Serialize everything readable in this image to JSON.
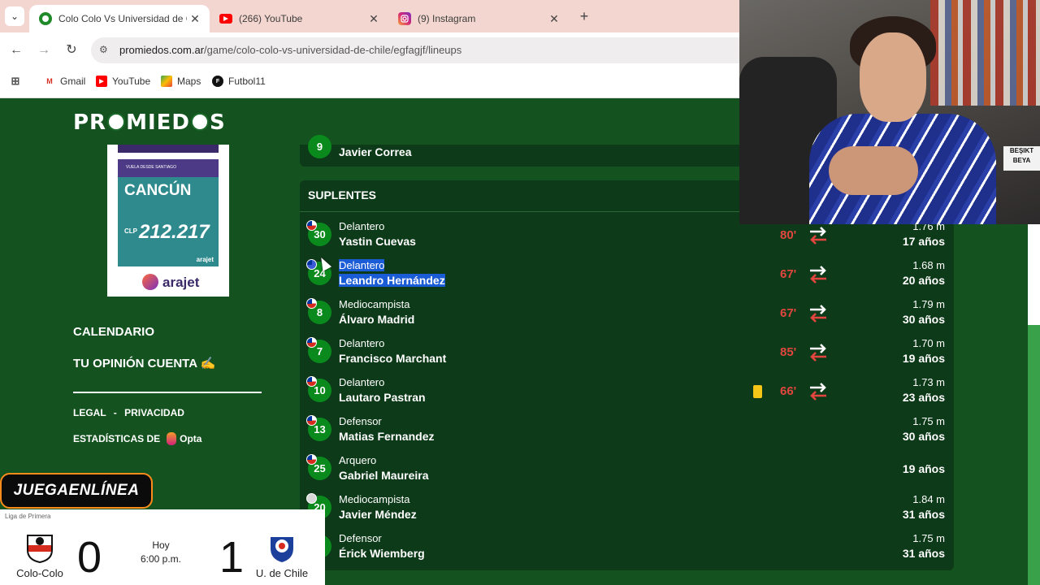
{
  "browser": {
    "tabs": [
      {
        "title": "Colo Colo Vs Universidad de Ch",
        "icon": "promiedos-icon",
        "active": true
      },
      {
        "title": "(266) YouTube",
        "icon": "youtube-icon",
        "active": false
      },
      {
        "title": "(9) Instagram",
        "icon": "instagram-icon",
        "active": false
      }
    ],
    "url_domain": "promiedos.com.ar",
    "url_path": "/game/colo-colo-vs-universidad-de-chile/egfagjf/lineups",
    "bookmarks": [
      "Gmail",
      "YouTube",
      "Maps",
      "Futbol11"
    ]
  },
  "site": {
    "logo_left": "PR",
    "logo_right": "MIED",
    "logo_end": "S"
  },
  "ad": {
    "header": "VUELA DESDE SANTIAGO",
    "destination": "CANCÚN",
    "currency": "CLP",
    "price": "212.217",
    "brand_small": "arajet",
    "brand": "arajet"
  },
  "sidebar": {
    "calendario": "CALENDARIO",
    "opinion": "TU OPINIÓN CUENTA",
    "legal": "LEGAL",
    "separator": "-",
    "privacidad": "PRIVACIDAD",
    "stats_label": "ESTADÍSTICAS DE",
    "stats_brand": "Opta"
  },
  "previous_player": {
    "number": "9",
    "name": "Javier Correa"
  },
  "substitutes": {
    "title": "SUPLENTES",
    "players": [
      {
        "number": "30",
        "position": "Delantero",
        "name": "Yastin Cuevas",
        "minute": "80'",
        "height": "1.76 m",
        "age": "17 años"
      },
      {
        "number": "24",
        "position": "Delantero",
        "name": "Leandro Hernández",
        "minute": "67'",
        "height": "1.68 m",
        "age": "20 años"
      },
      {
        "number": "8",
        "position": "Mediocampista",
        "name": "Álvaro Madrid",
        "minute": "67'",
        "height": "1.79 m",
        "age": "30 años"
      },
      {
        "number": "7",
        "position": "Delantero",
        "name": "Francisco Marchant",
        "minute": "85'",
        "height": "1.70 m",
        "age": "19 años"
      },
      {
        "number": "10",
        "position": "Delantero",
        "name": "Lautaro Pastran",
        "minute": "66'",
        "height": "1.73 m",
        "age": "23 años",
        "yellow_card": true
      },
      {
        "number": "13",
        "position": "Defensor",
        "name": "Matias Fernandez",
        "minute": "",
        "height": "1.75 m",
        "age": "30 años"
      },
      {
        "number": "25",
        "position": "Arquero",
        "name": "Gabriel Maureira",
        "minute": "",
        "height": "",
        "age": "19 años"
      },
      {
        "number": "20",
        "position": "Mediocampista",
        "name": "Javier Méndez",
        "minute": "",
        "height": "1.84 m",
        "age": "31 años"
      },
      {
        "number": "",
        "position": "Defensor",
        "name": "Érick Wiemberg",
        "minute": "",
        "height": "1.75 m",
        "age": "31 años"
      }
    ]
  },
  "webcam": {
    "sign_line1": "BEŞIKT",
    "sign_line2": "BEYA"
  },
  "overlay": {
    "badge": "JUEGAENLÍNEA",
    "league": "Liga de Primera",
    "home_team": "Colo-Colo",
    "home_score": "0",
    "away_team": "U. de Chile",
    "away_score": "1",
    "day": "Hoy",
    "time": "6:00 p.m."
  },
  "colors": {
    "accent_green": "#0a8a1c",
    "minute_red": "#e2463f",
    "highlight": "#1a5bd6",
    "badge_border": "#ff8c1a"
  }
}
